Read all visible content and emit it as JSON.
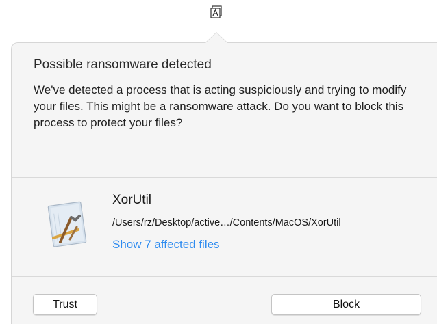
{
  "menubar": {
    "icon": "ransomwhere-menubar-icon"
  },
  "alert": {
    "title": "Possible ransomware detected",
    "message": "We've detected a process that is acting suspiciously and trying to modify your files. This might be a ransomware attack. Do you want to block this process to protect your files?"
  },
  "process": {
    "icon": "xcode-app-icon",
    "name": "XorUtil",
    "path": "/Users/rz/Desktop/active…/Contents/MacOS/XorUtil",
    "affected_link": "Show 7 affected files"
  },
  "buttons": {
    "trust_label": "Trust",
    "block_label": "Block"
  },
  "colors": {
    "link": "#2f8cf0",
    "popover_background": "#f5f5f5"
  }
}
